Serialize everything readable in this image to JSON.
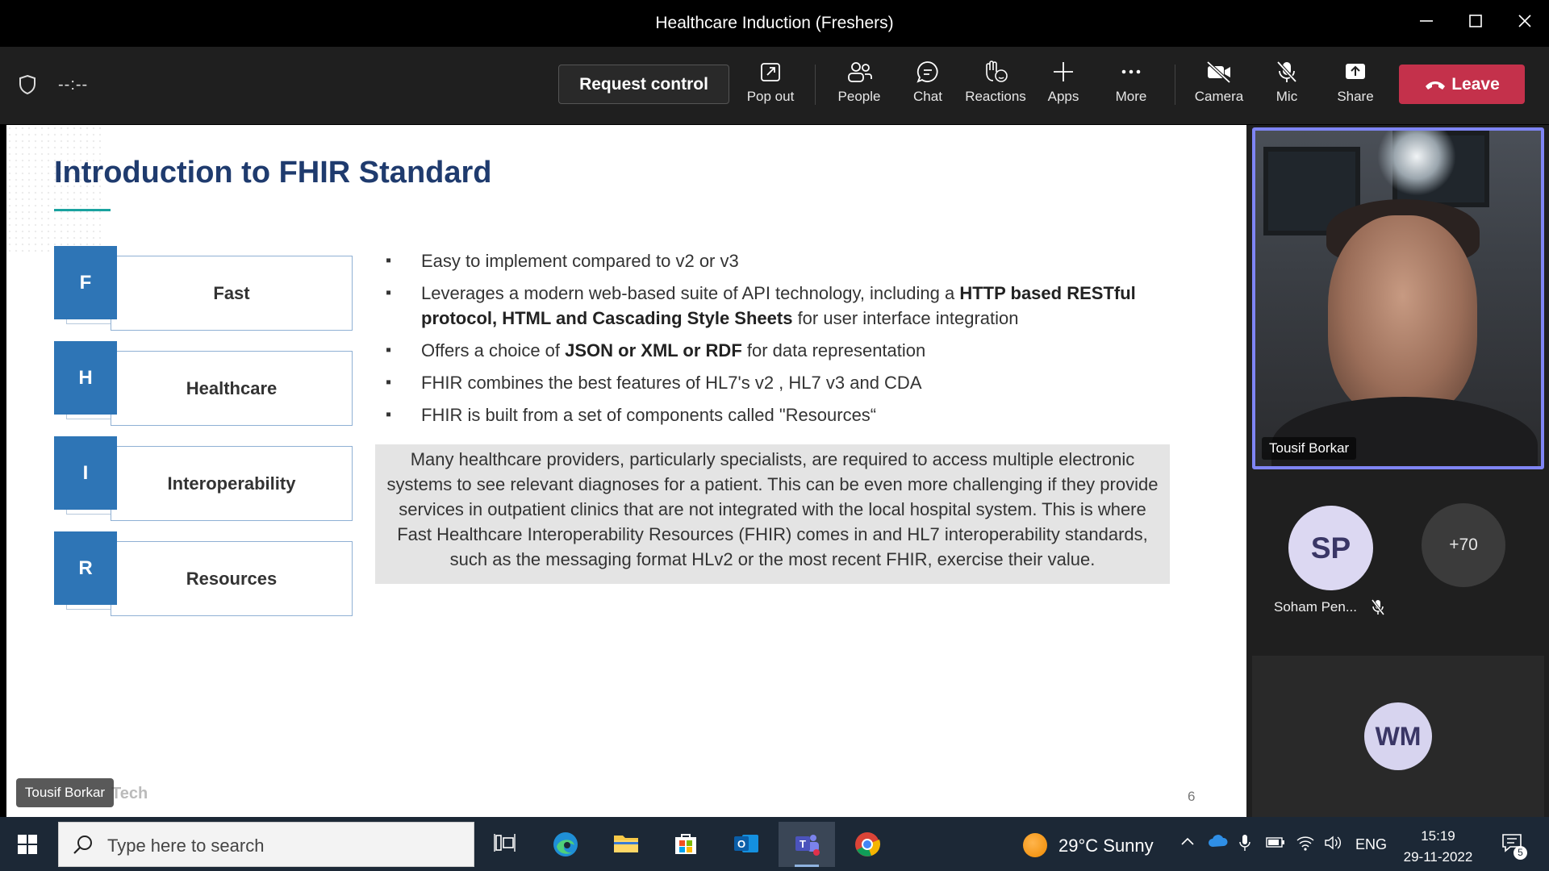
{
  "window": {
    "title": "Healthcare Induction (Freshers)"
  },
  "toolbar": {
    "timer": "--:--",
    "request_control": "Request control",
    "buttons": {
      "popout": "Pop out",
      "people": "People",
      "chat": "Chat",
      "reactions": "Reactions",
      "apps": "Apps",
      "more": "More",
      "camera": "Camera",
      "mic": "Mic",
      "share": "Share"
    },
    "leave": "Leave",
    "leave_color": "#c4314b",
    "accent_color": "#7f85f5"
  },
  "slide": {
    "title": "Introduction to FHIR Standard",
    "fhir": [
      {
        "letter": "F",
        "word": "Fast"
      },
      {
        "letter": "H",
        "word": "Healthcare"
      },
      {
        "letter": "I",
        "word": "Interoperability"
      },
      {
        "letter": "R",
        "word": "Resources"
      }
    ],
    "bullets": [
      {
        "parts": [
          {
            "t": "Easy to implement compared to v2 or v3"
          }
        ]
      },
      {
        "parts": [
          {
            "t": "Leverages a modern web-based suite of API technology, including a "
          },
          {
            "t": "HTTP based RESTful protocol, HTML and Cascading Style Sheets",
            "b": true
          },
          {
            "t": " for user interface integration"
          }
        ]
      },
      {
        "parts": [
          {
            "t": "Offers a choice of "
          },
          {
            "t": "JSON or XML or RDF",
            "b": true
          },
          {
            "t": " for data representation"
          }
        ]
      },
      {
        "parts": [
          {
            "t": "FHIR combines the best features of HL7's v2 , HL7 v3  and CDA"
          }
        ]
      },
      {
        "parts": [
          {
            "t": "FHIR is built from a set of components called \"Resources“"
          }
        ]
      }
    ],
    "quote": "Many healthcare providers, particularly specialists, are required to access multiple electronic systems to see relevant diagnoses for a patient. This can be even more challenging if they provide services in outpatient clinics that are not integrated with the local hospital system. This is where Fast Healthcare Interoperability Resources (FHIR) comes in and HL7 interoperability standards, such as the messaging format HLv2 or the most recent FHIR, exercise their value.",
    "page_number": "6",
    "brand": "Tech",
    "presenter_tag": "Tousif Borkar",
    "brand_color": "#1f3b6e",
    "box_color": "#2e75b6"
  },
  "participants": {
    "presenter": "Tousif Borkar",
    "sp_initials": "SP",
    "sp_name": "Soham Pen...",
    "more_count": "+70",
    "wm_initials": "WM"
  },
  "taskbar": {
    "search_placeholder": "Type here to search",
    "weather": "29°C  Sunny",
    "language": "ENG",
    "time": "15:19",
    "date": "29-11-2022",
    "notifications": "5"
  }
}
